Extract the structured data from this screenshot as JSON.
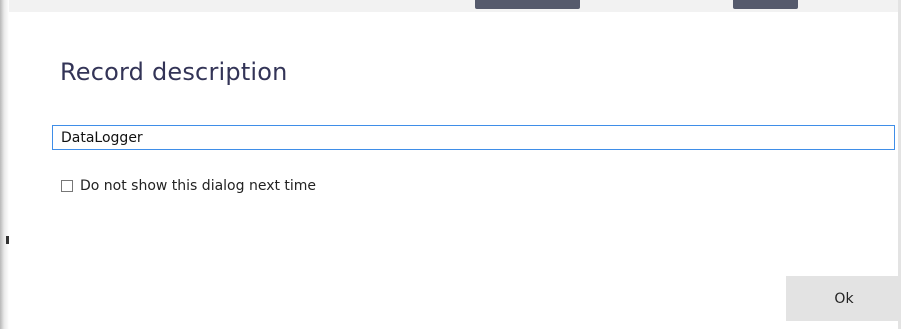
{
  "dialog": {
    "title": "Record description",
    "description_input": {
      "value": "DataLogger",
      "placeholder": ""
    },
    "dont_show_checkbox": {
      "label": "Do not show this dialog next time",
      "checked": false
    },
    "ok_button_label": "Ok"
  },
  "colors": {
    "title": "#333457",
    "input_focus_border": "#3f8ee8",
    "button_bg": "#e3e3e3"
  }
}
